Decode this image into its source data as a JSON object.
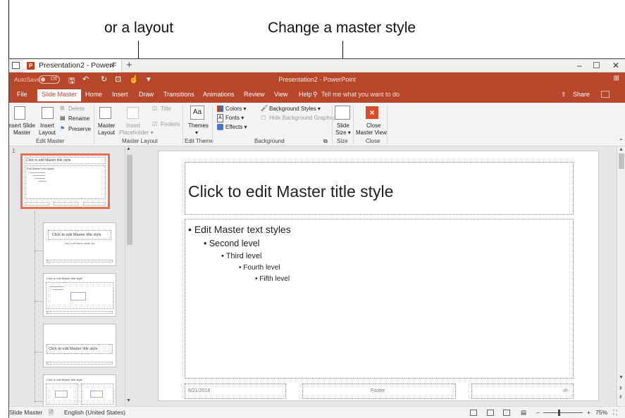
{
  "annotations": {
    "layout_callout": "or a layout",
    "master_style_callout": "Change a master style"
  },
  "window": {
    "tab_title": "Presentation2 - PowerF",
    "tab_close": "×",
    "tab_new": "+",
    "minimize": "–",
    "restore": "☐",
    "close": "✕"
  },
  "qat": {
    "autosave": "AutoSave",
    "toggle_state": "Off",
    "doc_title": "Presentation2  -  PowerPoint",
    "ribbon_options": "⊞"
  },
  "menu": {
    "items": [
      "File",
      "Slide Master",
      "Home",
      "Insert",
      "Draw",
      "Transitions",
      "Animations",
      "Review",
      "View",
      "Help"
    ],
    "active": "Slide Master",
    "tellme": "Tell me what you want to do",
    "share": "Share"
  },
  "ribbon": {
    "insert_slide_master": [
      "Insert Slide",
      "Master"
    ],
    "insert_layout": [
      "Insert",
      "Layout"
    ],
    "delete": "Delete",
    "rename": "Rename",
    "preserve": "Preserve",
    "group_edit_master": "Edit Master",
    "master_layout_btn": [
      "Master",
      "Layout"
    ],
    "insert_placeholder": [
      "Insert",
      "Placeholder ▾"
    ],
    "title_chk": "Title",
    "footers_chk": "Footers",
    "group_master_layout": "Master Layout",
    "themes": "Themes",
    "themes_arrow": "▾",
    "group_edit_theme": "Edit Theme",
    "colors": "Colors ▾",
    "fonts": "Fonts ▾",
    "effects": "Effects ▾",
    "background_styles": "Background Styles ▾",
    "hide_background": "Hide Background Graphics",
    "group_background": "Background",
    "slide_size": [
      "Slide",
      "Size ▾"
    ],
    "group_size": "Size",
    "close_master": [
      "Close",
      "Master View"
    ],
    "group_close": "Close"
  },
  "thumbnails": {
    "slide_number": "1",
    "master_title": "Click to edit Master title style",
    "master_text": "Edit Master text styles",
    "layout_title": "Click to edit Master title style",
    "layout_subtitle": "Click to edit Master subtitle style"
  },
  "slide": {
    "title": "Click to edit Master title style",
    "bullets": [
      {
        "text": "• Edit Master text styles",
        "level": 1
      },
      {
        "text": "• Second level",
        "level": 2
      },
      {
        "text": "• Third level",
        "level": 3
      },
      {
        "text": "• Fourth level",
        "level": 4
      },
      {
        "text": "• Fifth level",
        "level": 5
      }
    ],
    "footer_date": "6/21/2018",
    "footer_text": "Footer",
    "footer_num": "‹#›"
  },
  "status": {
    "view": "Slide Master",
    "language": "English (United States)",
    "zoom": "75%",
    "zoom_minus": "–",
    "zoom_plus": "+"
  }
}
